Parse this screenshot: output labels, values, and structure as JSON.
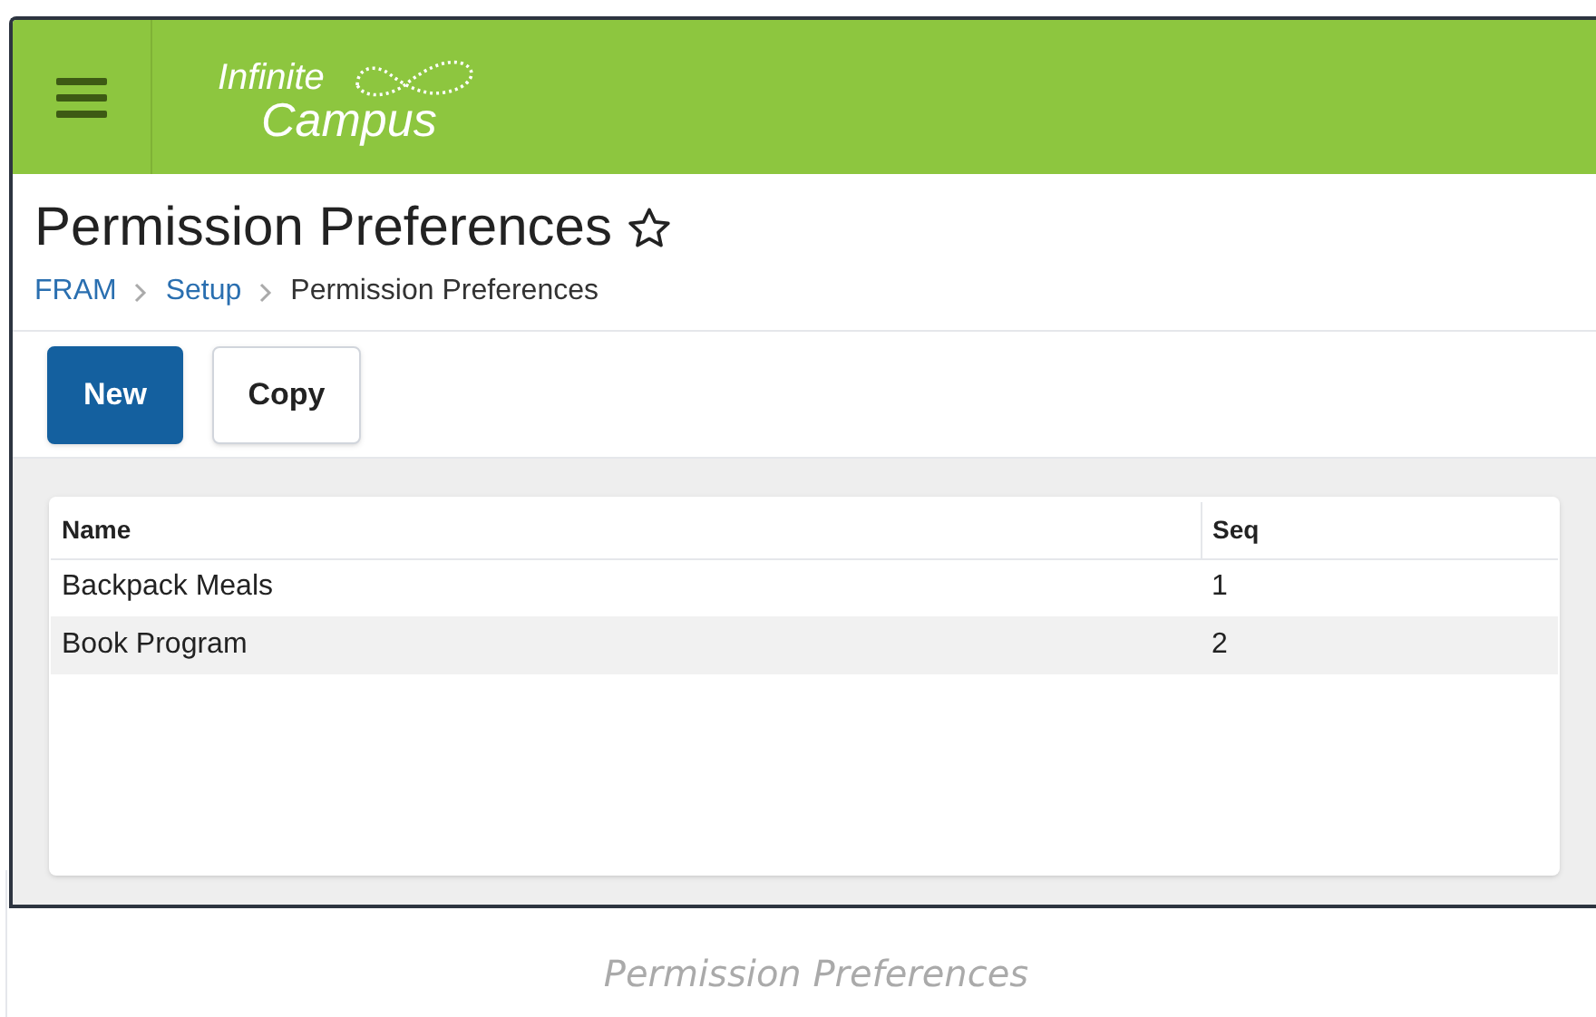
{
  "header": {
    "logo": {
      "line_1": "Infinite",
      "line_2": "Campus"
    }
  },
  "page": {
    "title": "Permission Preferences",
    "breadcrumb": [
      "FRAM",
      "Setup",
      "Permission Preferences"
    ]
  },
  "toolbar": {
    "buttons": [
      {
        "label": "New",
        "kind": "primary"
      },
      {
        "label": "Copy",
        "kind": "secondary"
      }
    ]
  },
  "table": {
    "columns": [
      "Name",
      "Seq"
    ],
    "rows": [
      [
        "Backpack Meals",
        "1"
      ],
      [
        "Book Program",
        "2"
      ]
    ]
  },
  "caption": "Permission Preferences"
}
